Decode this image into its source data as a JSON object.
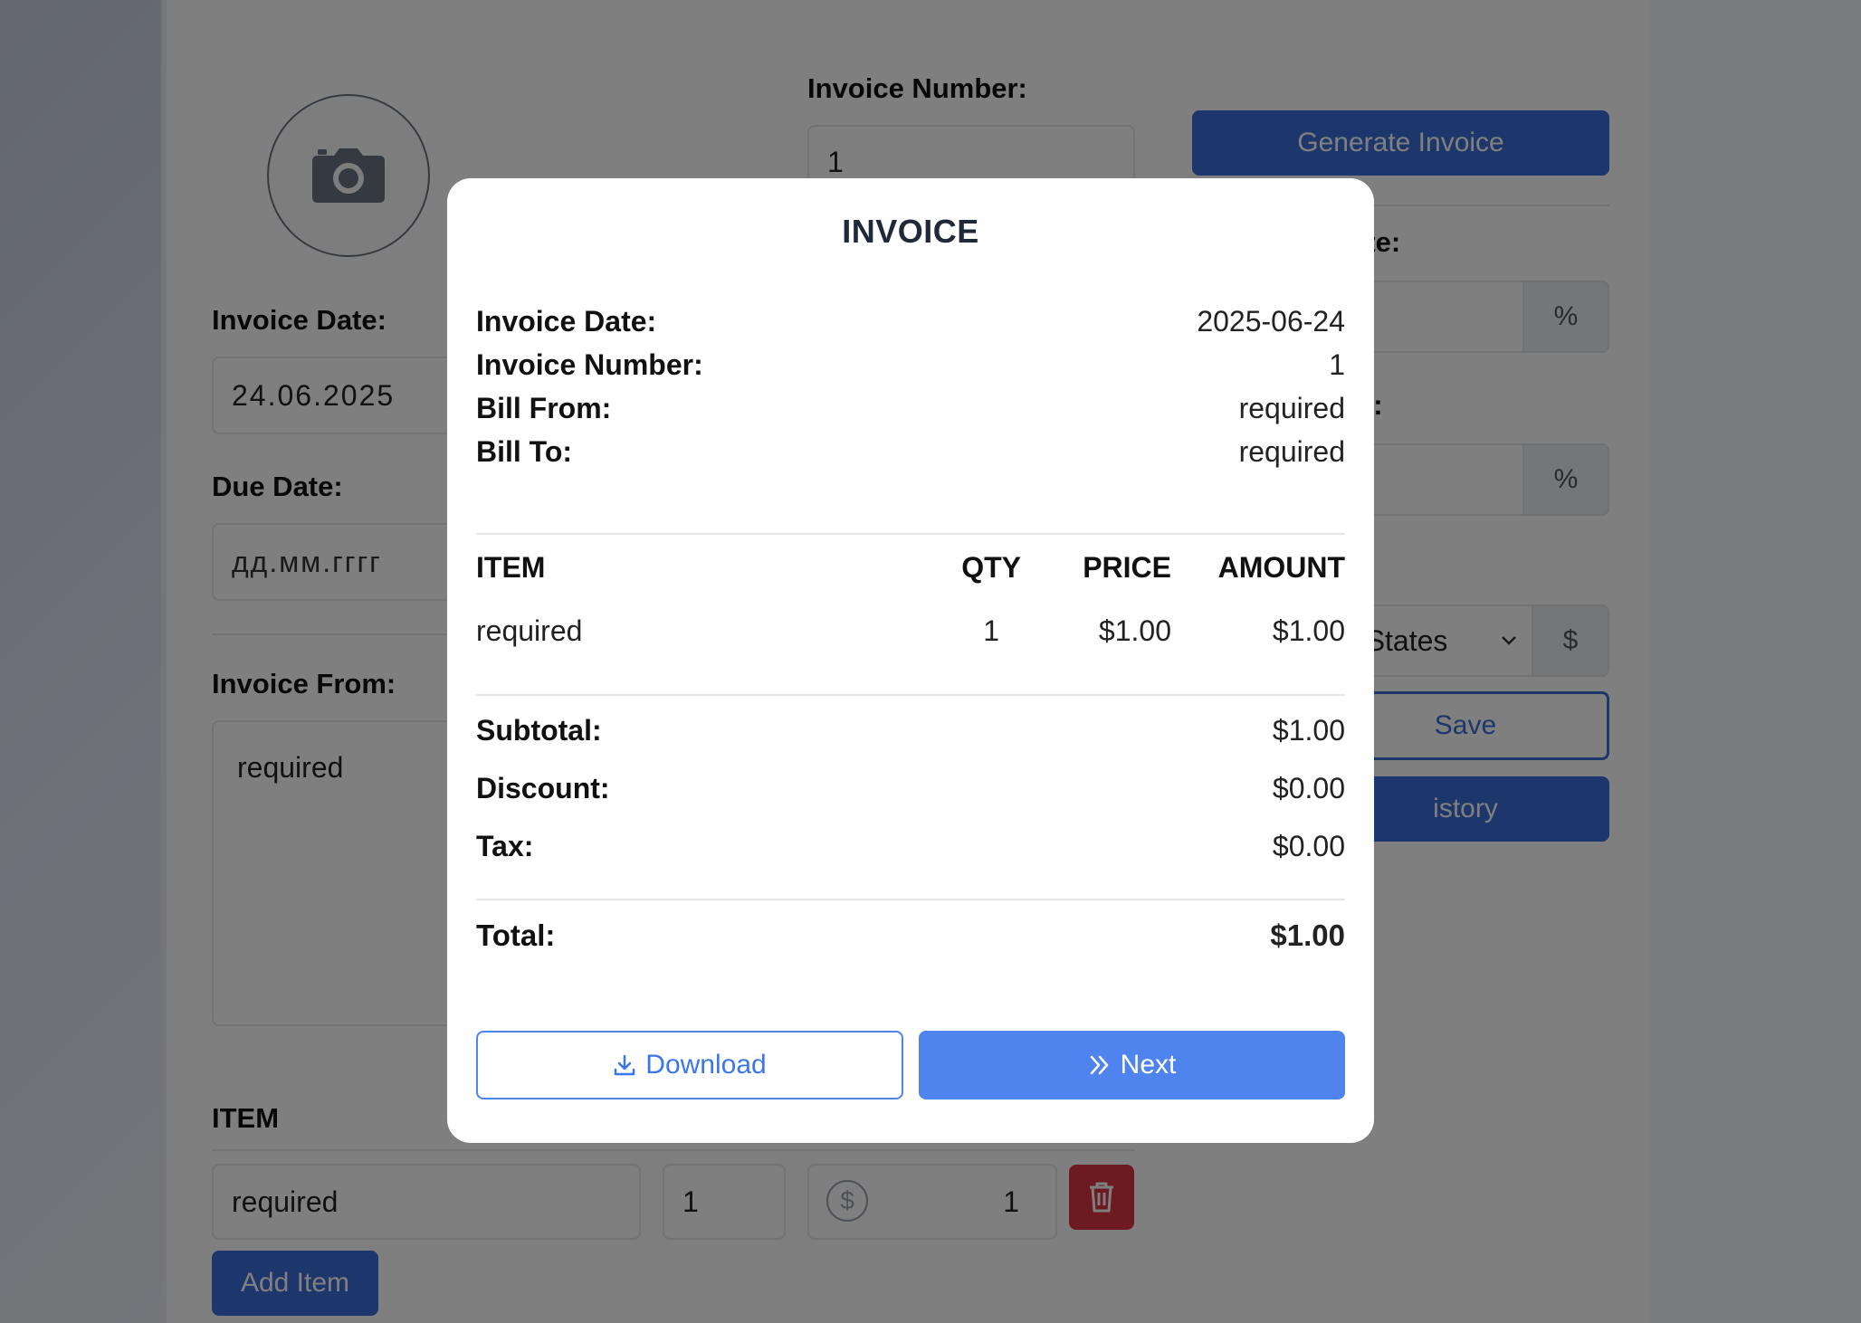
{
  "form": {
    "invoice_number_label": "Invoice Number:",
    "invoice_number_value": "1",
    "generate_button": "Generate Invoice",
    "invoice_date_label": "Invoice Date:",
    "invoice_date_value": "24.06.2025",
    "due_date_label": "Due Date:",
    "due_date_placeholder": "дд.мм.гггг",
    "invoice_from_label": "Invoice From:",
    "invoice_from_value": "required",
    "tax_rate_label_partial": "rate:",
    "discount_label_partial": "e:",
    "percent_symbol": "%",
    "currency_partial": "d States",
    "currency_symbol": "$",
    "save_button_partial": "Save",
    "history_button_partial": "istory",
    "item_header": "ITEM",
    "item_name_value": "required",
    "item_qty_value": "1",
    "item_price_value": "1",
    "add_item_button": "Add Item"
  },
  "modal": {
    "title": "INVOICE",
    "details": [
      {
        "label": "Invoice Date:",
        "value": "2025-06-24"
      },
      {
        "label": "Invoice Number:",
        "value": "1"
      },
      {
        "label": "Bill From:",
        "value": "required"
      },
      {
        "label": "Bill To:",
        "value": "required"
      }
    ],
    "table": {
      "headers": [
        "ITEM",
        "QTY",
        "PRICE",
        "AMOUNT"
      ],
      "rows": [
        {
          "item": "required",
          "qty": "1",
          "price": "$1.00",
          "amount": "$1.00"
        }
      ]
    },
    "summary": [
      {
        "label": "Subtotal:",
        "value": "$1.00"
      },
      {
        "label": "Discount:",
        "value": "$0.00"
      },
      {
        "label": "Tax:",
        "value": "$0.00"
      }
    ],
    "total": {
      "label": "Total:",
      "value": "$1.00"
    },
    "download_button": "Download",
    "next_button": "Next"
  },
  "colors": {
    "primary": "#4f84ee",
    "danger": "#dc3545",
    "overlay": "rgba(0,0,0,0.5)"
  }
}
